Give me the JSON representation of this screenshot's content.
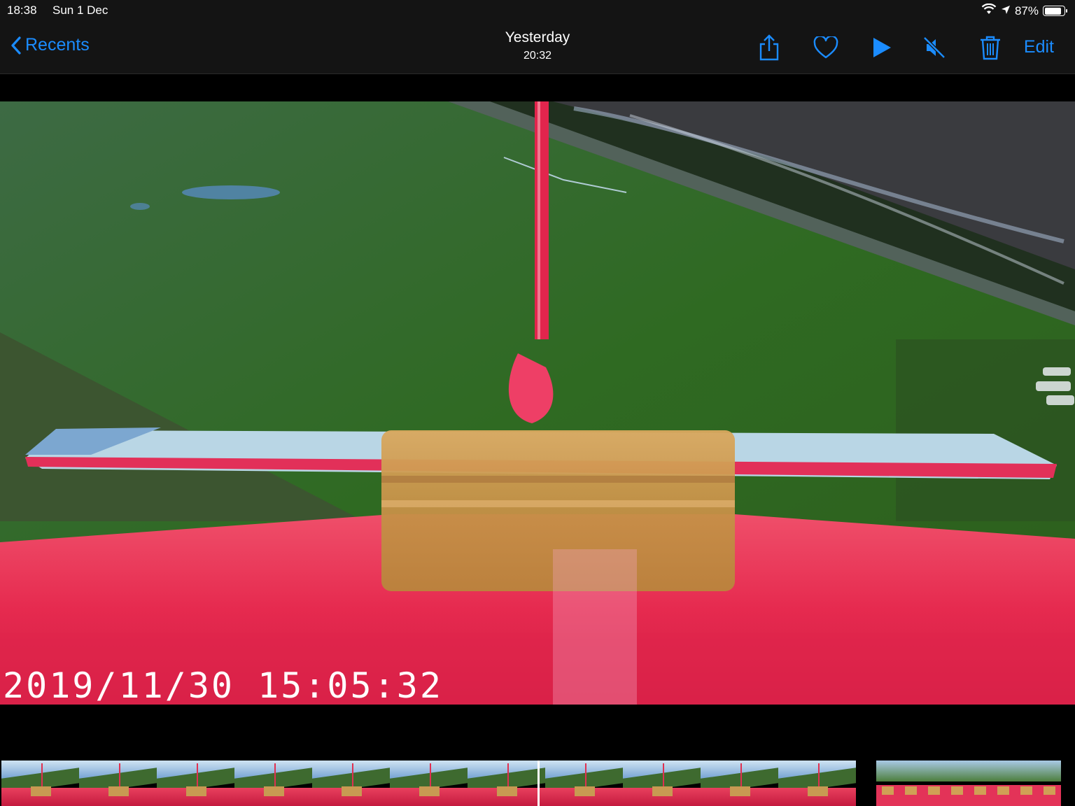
{
  "status_bar": {
    "time": "18:38",
    "date": "Sun 1 Dec",
    "battery": "87%",
    "battery_level": 0.87,
    "icons": [
      "wifi-icon",
      "location-icon",
      "battery-icon"
    ]
  },
  "nav": {
    "back_label": "Recents",
    "title": "Yesterday",
    "subtitle": "20:32",
    "edit_label": "Edit",
    "accent": "#1b8cff",
    "toolbar_icons": [
      "share-icon",
      "heart-icon",
      "play-icon",
      "mute-icon",
      "trash-icon"
    ]
  },
  "video": {
    "timestamp": "2019/11/30  15:05:32"
  },
  "scrubber": {
    "frame_count": 11,
    "mini_frame_count": 8
  }
}
